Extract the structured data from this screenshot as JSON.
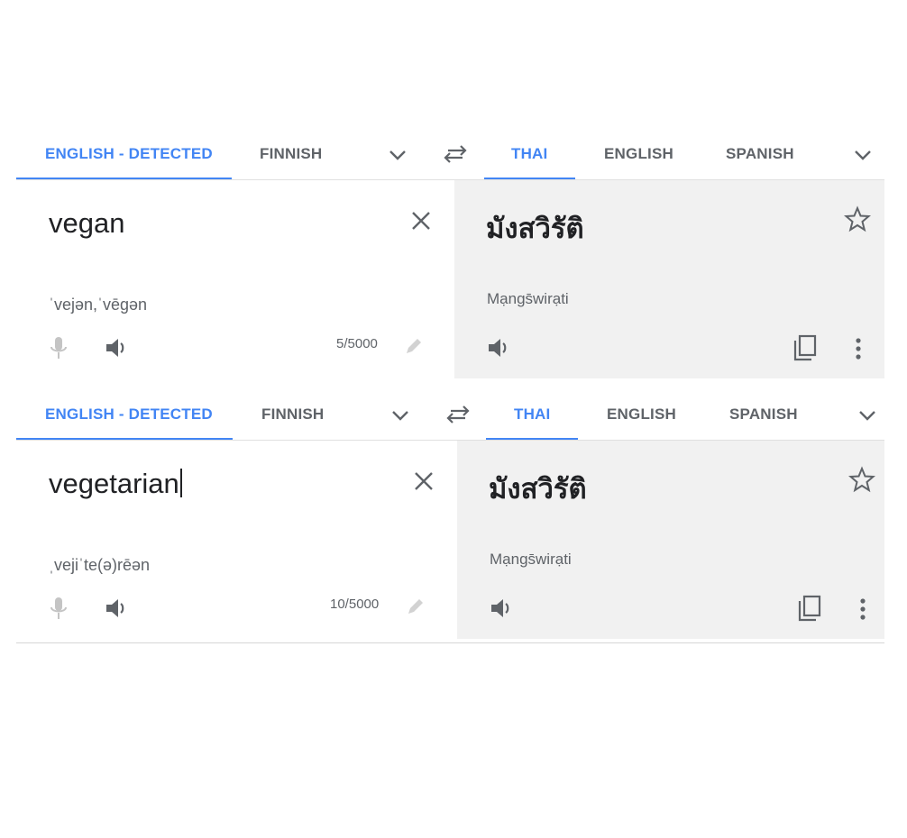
{
  "colors": {
    "accent": "#4285f4",
    "tab_text": "#5f6368",
    "target_bg": "#f1f1f1",
    "text": "#202124",
    "icon_disabled": "#c4c4c4",
    "icon": "#5f6368"
  },
  "panels": [
    {
      "source_tabs": [
        "ENGLISH - DETECTED",
        "FINNISH"
      ],
      "target_tabs": [
        "THAI",
        "ENGLISH",
        "SPANISH"
      ],
      "source_text": "vegan",
      "phonetic": "ˈvejən,ˈvēgən",
      "char_count": "5/5000",
      "translation": "มังสวิรัติ",
      "transliteration": "Mạngs̄wirạti",
      "icons": [
        "chevron-down-icon",
        "swap-icon",
        "close-icon",
        "mic-icon",
        "speaker-icon",
        "edit-icon",
        "star-icon",
        "copy-icon",
        "more-vert-icon"
      ]
    },
    {
      "source_tabs": [
        "ENGLISH - DETECTED",
        "FINNISH"
      ],
      "target_tabs": [
        "THAI",
        "ENGLISH",
        "SPANISH"
      ],
      "source_text": "vegetarian",
      "phonetic": "ˌvejiˈte(ə)rēən",
      "char_count": "10/5000",
      "translation": "มังสวิรัติ",
      "transliteration": "Mạngs̄wirạti",
      "icons": [
        "chevron-down-icon",
        "swap-icon",
        "close-icon",
        "mic-icon",
        "speaker-icon",
        "edit-icon",
        "star-icon",
        "copy-icon",
        "more-vert-icon"
      ]
    }
  ]
}
